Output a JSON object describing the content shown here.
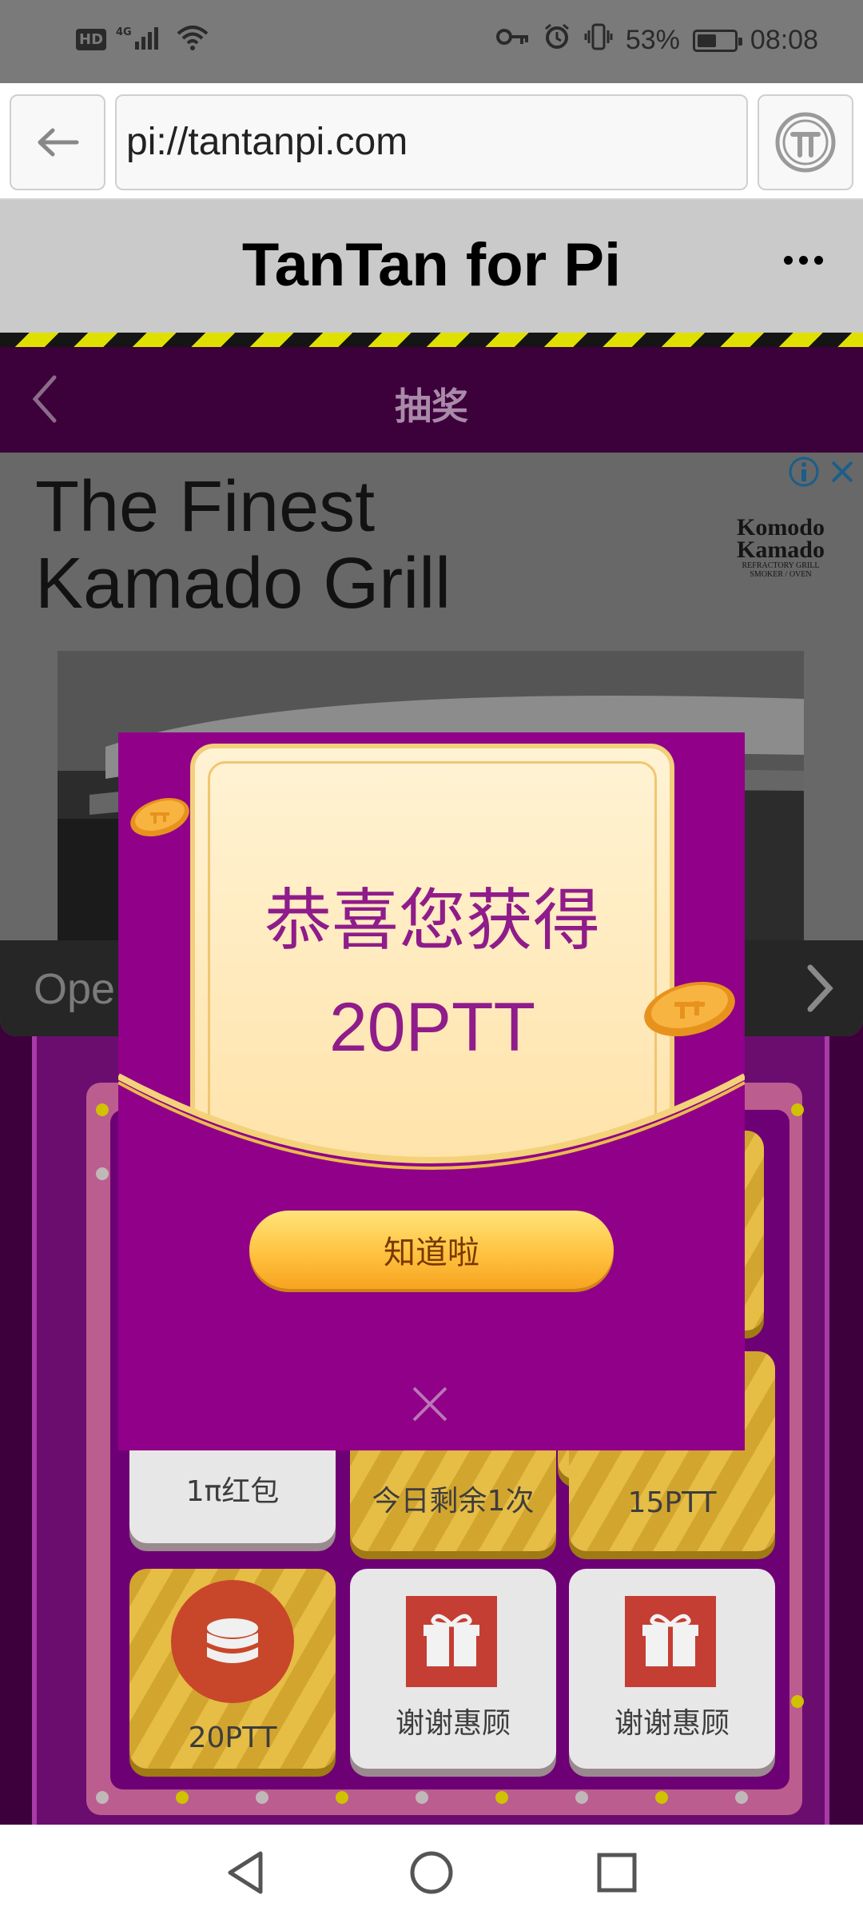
{
  "status_bar": {
    "network_badge": "HD",
    "network_type": "4G",
    "battery": "53%",
    "battery_level": 0.53,
    "time": "08:08",
    "icons": [
      "hd-icon",
      "signal-4g-icon",
      "wifi-icon",
      "key-icon",
      "alarm-icon",
      "vibrate-icon",
      "battery-icon"
    ]
  },
  "browser": {
    "url": "pi://tantanpi.com",
    "back_icon": "arrow-left-icon",
    "pi_icon": "pi-logo-icon"
  },
  "app_header": {
    "title": "TanTan for Pi",
    "menu_icon": "more-horizontal-icon"
  },
  "page_nav": {
    "title": "抽奖",
    "back_icon": "chevron-left-icon"
  },
  "ad": {
    "headline_line1": "The Finest",
    "headline_line2": "Kamado Grill",
    "logo_line1": "Komodo",
    "logo_line2": "Kamado",
    "logo_tagline1": "REFRACTORY GRILL",
    "logo_tagline2": "SMOKER / OVEN",
    "cta_text": "Ope",
    "info_icon": "info-icon",
    "close_icon": "close-icon",
    "arrow_icon": "chevron-right-icon"
  },
  "prize_grid": {
    "cells": [
      {
        "label": "1π红包",
        "style": "plain"
      },
      {
        "label": "今日剩余1次",
        "style": "gold"
      },
      {
        "label": "15PTT",
        "style": "gold"
      },
      {
        "label": "20PTT",
        "style": "gold"
      },
      {
        "label": "谢谢惠顾",
        "style": "plain"
      },
      {
        "label": "谢谢惠顾",
        "style": "plain"
      }
    ]
  },
  "modal": {
    "line1": "恭喜您获得",
    "line2": "20PTT",
    "ok_label": "知道啦",
    "close_icon": "close-icon"
  },
  "system_nav": {
    "icons": [
      "back-triangle-icon",
      "home-circle-icon",
      "recents-square-icon"
    ]
  },
  "colors": {
    "modal_bg": "#900088",
    "nav_bg": "#3c003b",
    "accent_text": "#8f1c8a",
    "button_gold": "#ffc240"
  }
}
